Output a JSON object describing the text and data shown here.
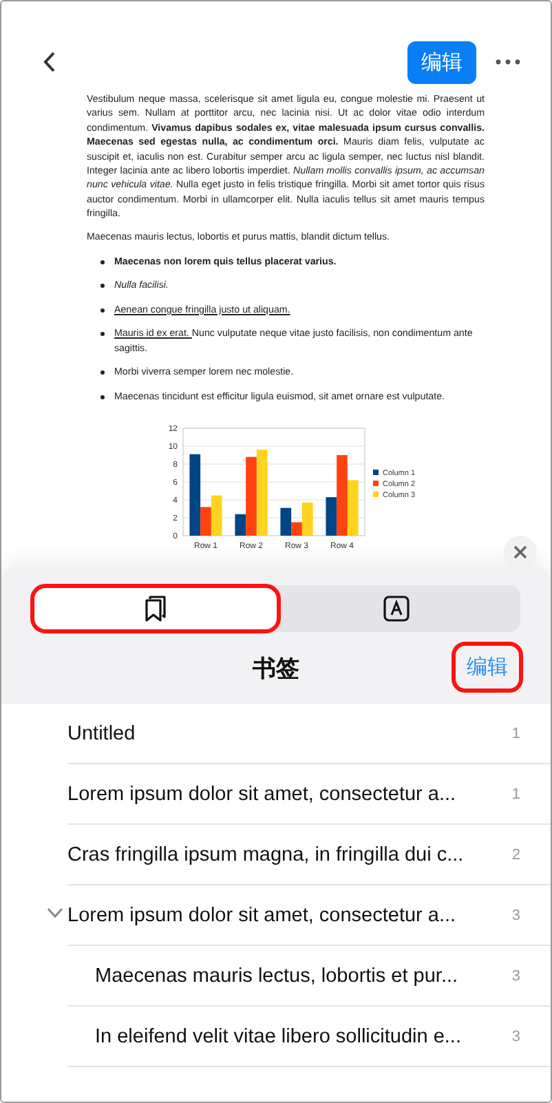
{
  "nav": {
    "edit_button": "编辑"
  },
  "document": {
    "paragraphs": [
      "Vestibulum neque massa, scelerisque sit amet ligula eu, congue molestie mi. Praesent ut varius sem. Nullam at porttitor arcu, nec lacinia nisi. Ut ac dolor vitae odio interdum condimentum. **Vivamus dapibus sodales ex, vitae malesuada ipsum cursus convallis. Maecenas sed egestas nulla, ac condimentum orci.** Mauris diam felis, vulputate ac suscipit et, iaculis non est. Curabitur semper arcu ac ligula semper, nec luctus nisl blandit. Integer lacinia ante ac libero lobortis imperdiet. *Nullam mollis convallis ipsum, ac accumsan nunc vehicula vitae.* Nulla eget justo in felis tristique fringilla. Morbi sit amet tortor quis risus auctor condimentum. Morbi in ullamcorper elit. Nulla iaculis tellus sit amet mauris tempus fringilla.",
      "Maecenas mauris lectus, lobortis et purus mattis, blandit dictum tellus."
    ],
    "bullets": [
      {
        "parts": [
          {
            "text": "Maecenas non lorem quis tellus placerat varius.",
            "kind": "bold"
          }
        ]
      },
      {
        "parts": [
          {
            "text": "Nulla facilisi.",
            "kind": "italic"
          }
        ]
      },
      {
        "parts": [
          {
            "text": "Aenean congue fringilla justo ut aliquam. ",
            "kind": "underline"
          }
        ]
      },
      {
        "parts": [
          {
            "text": "Mauris id ex erat. ",
            "kind": "underline"
          },
          {
            "text": "Nunc vulputate neque vitae justo facilisis, non condimentum ante sagittis.",
            "kind": "plain"
          }
        ]
      },
      {
        "parts": [
          {
            "text": "Morbi viverra semper lorem nec molestie.",
            "kind": "plain"
          }
        ]
      },
      {
        "parts": [
          {
            "text": "Maecenas tincidunt est efficitur ligula euismod, sit amet ornare est vulputate.",
            "kind": "plain"
          }
        ]
      }
    ],
    "chart_data": {
      "type": "bar",
      "grid": true,
      "legend": "right",
      "categories": [
        "Row 1",
        "Row 2",
        "Row 3",
        "Row 4"
      ],
      "ylim": [
        0,
        12
      ],
      "yticks": [
        0,
        2,
        4,
        6,
        8,
        10,
        12
      ],
      "series": [
        {
          "name": "Column 1",
          "color": "#004586",
          "values": [
            9.1,
            2.4,
            3.1,
            4.3
          ]
        },
        {
          "name": "Column 2",
          "color": "#ff420e",
          "values": [
            3.2,
            8.8,
            1.5,
            9.0
          ]
        },
        {
          "name": "Column 3",
          "color": "#ffd320",
          "values": [
            4.5,
            9.6,
            3.7,
            6.2
          ]
        }
      ]
    }
  },
  "sheet": {
    "tabs": [
      {
        "kind": "bookmarks",
        "selected": true,
        "highlighted": true
      },
      {
        "kind": "letter",
        "selected": false,
        "highlighted": false
      }
    ],
    "title": "书签",
    "edit_button": {
      "label": "编辑",
      "highlighted": true
    },
    "bookmarks": [
      {
        "title": "Untitled",
        "page": "1"
      },
      {
        "title": "Lorem ipsum dolor sit amet, consectetur a...",
        "page": "1"
      },
      {
        "title": "Cras fringilla ipsum magna, in fringilla dui c...",
        "page": "2"
      },
      {
        "title": "Lorem ipsum dolor sit amet, consectetur a...",
        "page": "3",
        "expanded": true,
        "children": [
          {
            "title": "Maecenas mauris lectus, lobortis et pur...",
            "page": "3"
          },
          {
            "title": "In eleifend velit vitae libero sollicitudin e...",
            "page": "3"
          }
        ]
      }
    ]
  }
}
